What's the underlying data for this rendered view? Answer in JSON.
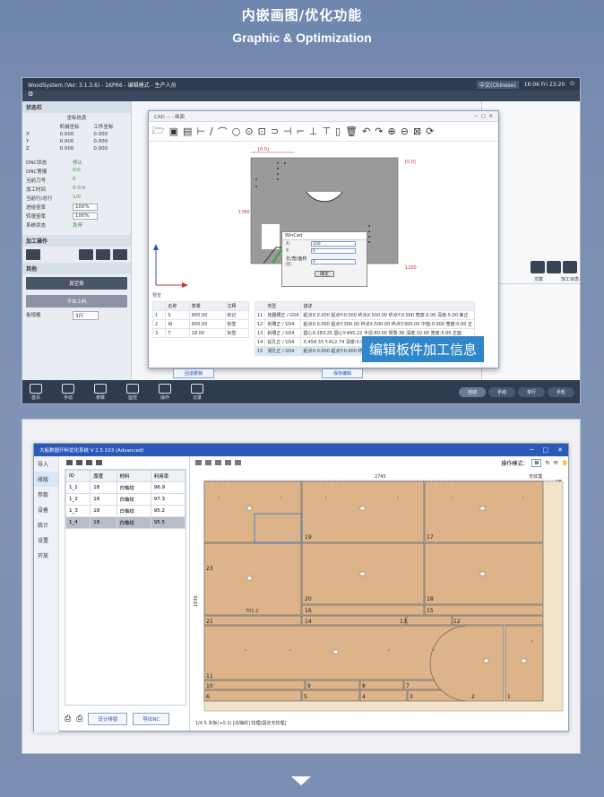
{
  "header": {
    "title": "内嵌画图/优化功能",
    "subtitle": "Graphic & Optimization"
  },
  "panel1": {
    "app_title": "WoodSystem (Ver: 3.1.3.6) - 1KPR6 - 编辑模式 - 生产人员",
    "lang": "中文(Chinese)",
    "time": "16:06 Fri 23:20",
    "status_section": "状态栏",
    "coord_header": "坐标信息",
    "machine_coord": "机械坐标",
    "work_coord": "工件坐标",
    "axes": [
      {
        "name": "X",
        "m": "0.000",
        "w": "0.000"
      },
      {
        "name": "Y",
        "m": "0.000",
        "w": "0.000"
      },
      {
        "name": "Z",
        "m": "0.000",
        "w": "0.000"
      }
    ],
    "status_rows": [
      {
        "k": "DNC状态",
        "v": "停止"
      },
      {
        "k": "DNC警报",
        "v": "0/0"
      },
      {
        "k": "当前刀号",
        "v": "0"
      },
      {
        "k": "加工时间",
        "v": "0:0:0"
      },
      {
        "k": "当前行/总行",
        "v": "1/0"
      },
      {
        "k": "进给倍率",
        "v": "100%"
      },
      {
        "k": "转速倍率",
        "v": "100%"
      },
      {
        "k": "系统状态",
        "v": "急停"
      }
    ],
    "side_labels": [
      "始头号",
      "坐标",
      "进给速",
      "主轴转"
    ],
    "process_section": "加工操作",
    "other_section": "其他",
    "buttons": [
      "真空泵",
      "真空泵",
      "平台上料",
      "平台下料"
    ],
    "board_label": "板规格",
    "board_value": "3尺",
    "right_cols": [
      "次数",
      "加工状态"
    ],
    "bottom_tabs": [
      {
        "label": "首页"
      },
      {
        "label": "手动"
      },
      {
        "label": "参数"
      },
      {
        "label": "监控"
      },
      {
        "label": "操作"
      },
      {
        "label": "记录"
      }
    ],
    "mode_tabs": [
      "自动",
      "手动",
      "单行",
      "手轮"
    ],
    "cad": {
      "title": "CAD -- - 画面",
      "dialog_title": "WinCad",
      "dialog_rows": [
        {
          "label": "X:",
          "value": "100"
        },
        {
          "label": "Y:",
          "value": "0"
        },
        {
          "label": "长/宽/面积(I):",
          "value": "0"
        }
      ],
      "dialog_ok": "确定",
      "dims": [
        "[0.0]",
        "[0.0]",
        "1200",
        "1380"
      ],
      "lower_label": "预览",
      "tool_headers": [
        "名称",
        "数量",
        "注释"
      ],
      "tools": [
        {
          "id": "1",
          "name": "S",
          "qty": "800.00",
          "note": "标记"
        },
        {
          "id": "2",
          "name": "W",
          "qty": "600.00",
          "note": "标签"
        },
        {
          "id": "3",
          "name": "T",
          "qty": "18.00",
          "note": "标签"
        }
      ],
      "op_headers": [
        "",
        "类型",
        "描述"
      ],
      "ops": [
        {
          "n": "11",
          "type": "挂翻槽正 / G54",
          "desc": "起点X:0.000  起点Y:0.000  终点X:500.00  终点Y:0.000  宽度:6.00  深度:5.00  孝正"
        },
        {
          "n": "12",
          "type": "划槽正 / G54",
          "desc": "起点X:0.000  起点Y:300.00  终点X:500.00  终点Y:300.00  中值:0.000  宽度:0.00  正"
        },
        {
          "n": "13",
          "type": "斜槽正 / G54",
          "desc": "圆心X:283.25  圆心Y:445.22  半径:80.00  倾角:36  深度:10.00  宽度:5.00  正面"
        },
        {
          "n": "14",
          "type": "钻孔正 / G54",
          "desc": "X:458.33  Y:412.74  深度:0.00  孔径:8.00  刀号:3  深度:5.00  正面"
        },
        {
          "n": "15",
          "type": "测孔正 / G54",
          "desc": "起点X:0.000  起点Y:0.000  终点X:0.000  终点Y:0.000  深度:6.00  正面"
        }
      ],
      "bottom_btns": [
        "回退撤销",
        "保存编辑",
        "退出返回"
      ]
    },
    "callout": "编辑板件加工信息"
  },
  "panel2": {
    "title": "大板数据开料优化系统 V 2.5.103 (Advanced)",
    "menu": [
      "导入",
      "排版",
      "参数",
      "设备",
      "统计",
      "设置",
      "开放"
    ],
    "list_headers": [
      "ID",
      "厚度",
      "材料",
      "利用率"
    ],
    "list_rows": [
      {
        "id": "1_1",
        "t": "18",
        "m": "白柚纹",
        "u": "96.9"
      },
      {
        "id": "1_2",
        "t": "18",
        "m": "白柚纹",
        "u": "97.3"
      },
      {
        "id": "1_3",
        "t": "18",
        "m": "白柚纹",
        "u": "95.2"
      },
      {
        "id": "1_4",
        "t": "18",
        "m": "白柚纹",
        "u": "95.5"
      }
    ],
    "btn_print": "设计排版",
    "btn_export": "导出NC",
    "mode_label": "操作模式：",
    "no_rule": "无纹理",
    "board_width": "2745",
    "board_height": "1830",
    "board_thick": "18",
    "inner_label": "701.2",
    "status": "1/4  5  本板(+0.1)  [白柚纹]  纹理[固定无纹理]",
    "parts": [
      "19",
      "17",
      "23",
      "20",
      "18",
      "16",
      "15",
      "21",
      "14",
      "13",
      "12",
      "11",
      "10",
      "9",
      "8",
      "7",
      "6",
      "5",
      "4",
      "3",
      "2",
      "1"
    ]
  }
}
